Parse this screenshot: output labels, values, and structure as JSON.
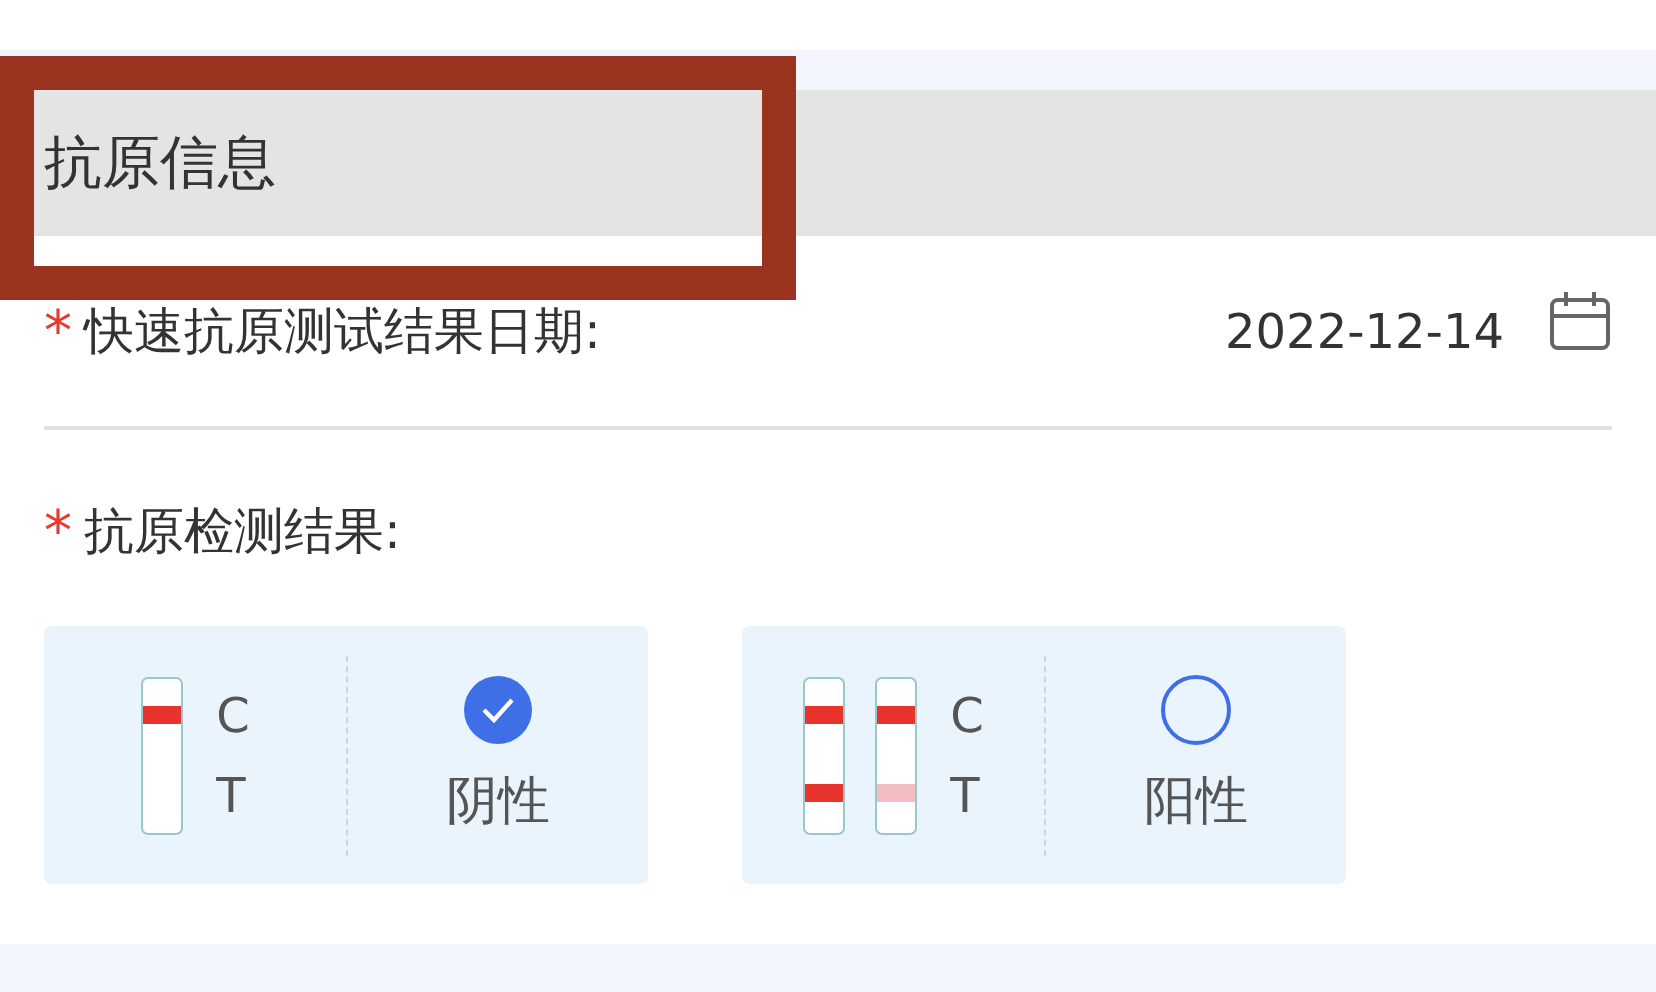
{
  "section": {
    "title": "抗原信息",
    "highlighted": true
  },
  "date_field": {
    "required_mark": "*",
    "label": "快速抗原测试结果日期:",
    "value": "2022-12-14"
  },
  "result_field": {
    "required_mark": "*",
    "label": "抗原检测结果:"
  },
  "options": [
    {
      "label": "阴性",
      "selected": true,
      "c_label": "C",
      "t_label": "T",
      "strips": [
        {
          "kind": "negative"
        }
      ]
    },
    {
      "label": "阳性",
      "selected": false,
      "c_label": "C",
      "t_label": "T",
      "strips": [
        {
          "kind": "positive"
        },
        {
          "kind": "weak"
        }
      ]
    }
  ]
}
